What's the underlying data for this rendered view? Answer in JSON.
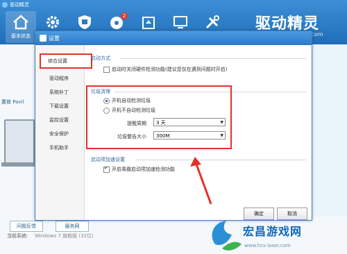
{
  "app": {
    "title": "驱动精灵",
    "brand": "驱动精灵",
    "brand_suffix": ".com",
    "toolbar": [
      {
        "label": "基本状态",
        "icon": "home-icon",
        "active": true
      },
      {
        "label": "",
        "icon": "gear-icon"
      },
      {
        "label": "",
        "icon": "shield-icon"
      },
      {
        "label": "",
        "icon": "disc-icon",
        "badge": "2"
      },
      {
        "label": "",
        "icon": "box-icon"
      },
      {
        "label": "",
        "icon": "monitor-icon"
      },
      {
        "label": "",
        "icon": "tools-icon"
      }
    ],
    "left_text": "惠普 Pavil",
    "bottom_buttons": [
      "问题反馈",
      "服务网"
    ],
    "system_label": "当前系统:",
    "system_value": "Windows 7 旗舰版 (32位)"
  },
  "dialog": {
    "title": "设置",
    "nav": [
      "综合设置",
      "驱动程序",
      "系统补丁",
      "下载设置",
      "监控设置",
      "安全保护",
      "手机助手"
    ],
    "active_nav": "综合设置",
    "startup": {
      "section_label": "启动方式",
      "option_label": "启动时关闭硬件检测功能(建议您仅在遇到问题时开启)",
      "checked": false
    },
    "cleanup": {
      "section_label": "垃圾清理",
      "radio_auto": "开机自动检测垃圾",
      "radio_manual": "开机不自动检测垃圾",
      "selected": "开机自动检测垃圾",
      "period_label": "提醒周期",
      "period_value": "3 天",
      "size_label": "垃圾警告大小",
      "size_value": "300M"
    },
    "boost": {
      "section_label": "启动项加速设置",
      "option_label": "开启毒霸启动项加速检测功能",
      "checked": true
    },
    "ok_label": "确定",
    "cancel_label": "取消"
  },
  "watermark": {
    "text": "宏昌游戏网",
    "url": "www.hcs-laser.com"
  },
  "colors": {
    "accent": "#2c7ac7",
    "highlight": "#e5302a"
  }
}
